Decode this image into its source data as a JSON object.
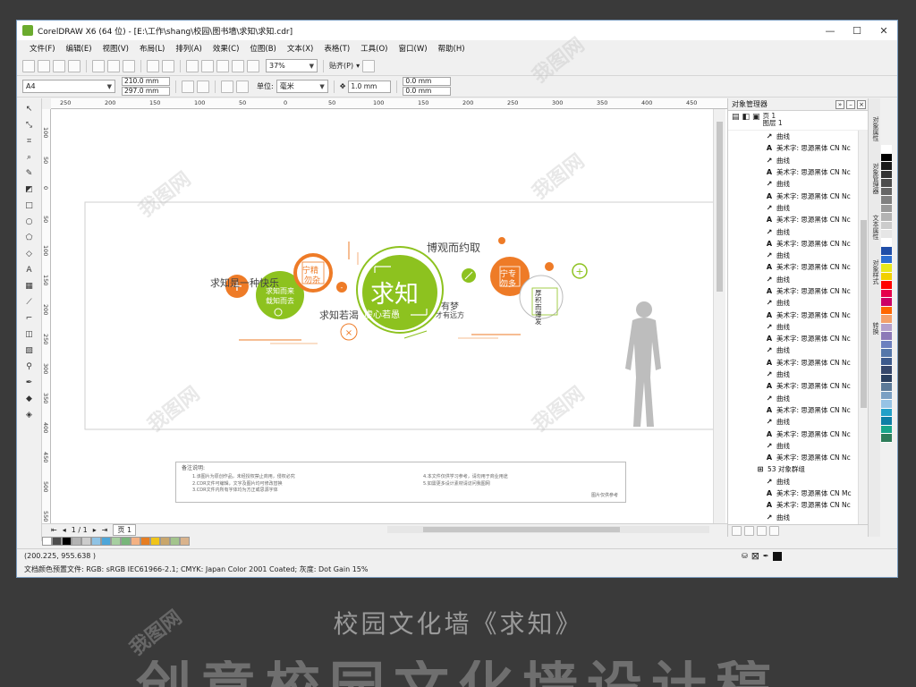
{
  "window": {
    "title": "CorelDRAW X6 (64 位) - [E:\\工作\\shang\\校园\\图书墙\\求知\\求知.cdr]",
    "min_icon": "minimize-icon",
    "max_icon": "maximize-icon",
    "close_icon": "close-icon"
  },
  "menu": [
    "文件(F)",
    "编辑(E)",
    "视图(V)",
    "布局(L)",
    "排列(A)",
    "效果(C)",
    "位图(B)",
    "文本(X)",
    "表格(T)",
    "工具(O)",
    "窗口(W)",
    "帮助(H)"
  ],
  "toolbar1": {
    "zoom": "37%",
    "snap_label": "贴齐(P)"
  },
  "toolbar2": {
    "page_size": "A4",
    "width": "210.0 mm",
    "height": "297.0 mm",
    "unit_label": "单位:",
    "unit": "毫米",
    "nudge": "1.0 mm",
    "dup_x": "0.0 mm",
    "dup_y": "0.0 mm"
  },
  "ruler": {
    "h_ticks": [
      "250",
      "200",
      "150",
      "100",
      "50",
      "0",
      "50",
      "100",
      "150",
      "200",
      "250",
      "300",
      "350",
      "400",
      "450"
    ],
    "v_ticks": [
      "100",
      "50",
      "0",
      "50",
      "100",
      "150",
      "200",
      "250",
      "300",
      "350",
      "400",
      "450",
      "500",
      "550"
    ]
  },
  "design": {
    "t1": "求知是一种快乐",
    "t2": "求知而来",
    "t3": "载知而去",
    "t4": "宁精",
    "t5": "勿杂",
    "t6": "求知",
    "t7": "虚心若愚",
    "t8": "求知若渴",
    "t9": "博观而约取",
    "t10": "有梦",
    "t11": "才有远方",
    "t12": "宁专",
    "t13": "勿多",
    "t14": "厚积而薄发",
    "note_title": "备注说明:",
    "note_lines_left": [
      "1.该图片为原创作品，未经授权禁止商用，侵权必究",
      "2.CDR文件可编辑，文字及图片均可修改替换",
      "3.CDR文件内所有字体均为方正或思源字体"
    ],
    "note_lines_right": [
      "4.本文件仅供学习参考，请勿用于商业用途",
      "5.如需更多设计素材请访问我图网"
    ],
    "note_footer": "图片仅供参考"
  },
  "page_nav": {
    "counter": "1 / 1",
    "page_tab": "页 1"
  },
  "status": {
    "coords": "(200.225, 955.638 )",
    "color_profile": "文档颜色预置文件: RGB: sRGB IEC61966-2.1; CMYK: Japan Color 2001 Coated; 灰度: Dot Gain 15%"
  },
  "objmgr": {
    "title": "对象管理器",
    "page": "页 1",
    "layer": "图层 1",
    "items": [
      {
        "icon": "curve-icon",
        "label": "曲线"
      },
      {
        "icon": "text-icon",
        "label": "美术字: 思源黑体 CN Nc"
      },
      {
        "icon": "curve-icon",
        "label": "曲线"
      },
      {
        "icon": "text-icon",
        "label": "美术字: 思源黑体 CN Nc"
      },
      {
        "icon": "curve-icon",
        "label": "曲线"
      },
      {
        "icon": "text-icon",
        "label": "美术字: 思源黑体 CN Nc"
      },
      {
        "icon": "curve-icon",
        "label": "曲线"
      },
      {
        "icon": "text-icon",
        "label": "美术字: 思源黑体 CN Nc"
      },
      {
        "icon": "curve-icon",
        "label": "曲线"
      },
      {
        "icon": "text-icon",
        "label": "美术字: 思源黑体 CN Nc"
      },
      {
        "icon": "curve-icon",
        "label": "曲线"
      },
      {
        "icon": "text-icon",
        "label": "美术字: 思源黑体 CN Nc"
      },
      {
        "icon": "curve-icon",
        "label": "曲线"
      },
      {
        "icon": "text-icon",
        "label": "美术字: 思源黑体 CN Nc"
      },
      {
        "icon": "curve-icon",
        "label": "曲线"
      },
      {
        "icon": "text-icon",
        "label": "美术字: 思源黑体 CN Nc"
      },
      {
        "icon": "curve-icon",
        "label": "曲线"
      },
      {
        "icon": "text-icon",
        "label": "美术字: 思源黑体 CN Nc"
      },
      {
        "icon": "curve-icon",
        "label": "曲线"
      },
      {
        "icon": "text-icon",
        "label": "美术字: 思源黑体 CN Nc"
      },
      {
        "icon": "curve-icon",
        "label": "曲线"
      },
      {
        "icon": "text-icon",
        "label": "美术字: 思源黑体 CN Nc"
      },
      {
        "icon": "curve-icon",
        "label": "曲线"
      },
      {
        "icon": "text-icon",
        "label": "美术字: 思源黑体 CN Nc"
      },
      {
        "icon": "curve-icon",
        "label": "曲线"
      },
      {
        "icon": "text-icon",
        "label": "美术字: 思源黑体 CN Nc"
      },
      {
        "icon": "curve-icon",
        "label": "曲线"
      },
      {
        "icon": "text-icon",
        "label": "美术字: 思源黑体 CN Nc"
      },
      {
        "icon": "group-icon",
        "label": "53 对象群组"
      },
      {
        "icon": "curve-icon",
        "label": "曲线"
      },
      {
        "icon": "text-icon",
        "label": "美术字: 思源黑体 CN Mc"
      },
      {
        "icon": "text-icon",
        "label": "美术字: 思源黑体 CN Nc"
      },
      {
        "icon": "curve-icon",
        "label": "曲线"
      },
      {
        "icon": "curve-icon",
        "label": "曲线"
      }
    ]
  },
  "docker_tabs": [
    "对象属性",
    "对象管理器",
    "文本属性",
    "对象样式",
    "转换"
  ],
  "colors": {
    "green": "#8dc21f",
    "orange": "#ee7b27",
    "accent_blue": "#7a9cbf"
  },
  "palette_right": [
    "#ffffff",
    "#000000",
    "#1a1a1a",
    "#333333",
    "#4d4d4d",
    "#666666",
    "#808080",
    "#999999",
    "#b3b3b3",
    "#cccccc",
    "#e6e6e6",
    "#ffffff",
    "#1f4ea8",
    "#2d6fd1",
    "#e8e81a",
    "#f2d000",
    "#ff0000",
    "#e6004c",
    "#cc0066",
    "#ff6600",
    "#f3a06b",
    "#b4a0cc",
    "#8d7ab8",
    "#6c80bf",
    "#5577aa",
    "#3d5a8c",
    "#36476b",
    "#2a3f5f",
    "#5c7a99",
    "#7ba0c4",
    "#96c3e5",
    "#23a0c8",
    "#0e7fa6",
    "#18a58a",
    "#2e7d5a"
  ],
  "palette_bottom": [
    "#ffffff",
    "#4d4d4d",
    "#000000",
    "#b3b3b3",
    "#cccccc",
    "#8fc3e5",
    "#4da6d9",
    "#a6cfa0",
    "#78b67a",
    "#f4b183",
    "#e67e22",
    "#f0c419",
    "#c9a66b",
    "#a3c48c",
    "#d9b38c"
  ],
  "caption": "校园文化墙《求知》",
  "banner": "创意校园文化墙设计稿"
}
